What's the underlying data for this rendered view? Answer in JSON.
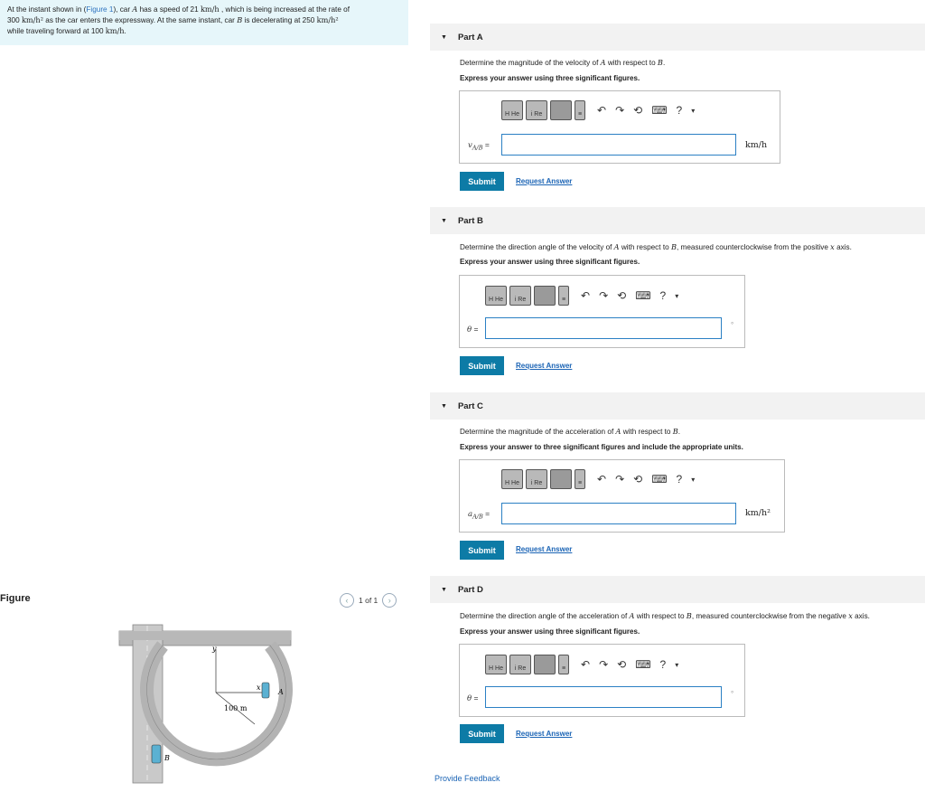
{
  "problem": {
    "line1_a": "At the instant shown in (",
    "line1_link": "Figure 1",
    "line1_b": "), car ",
    "line1_c": "A",
    "line1_d": " has a speed of 21 ",
    "line1_e": "km/h",
    "line1_f": " , which is being increased at the rate of",
    "line2_a": "300 ",
    "line2_b": "km/h²",
    "line2_c": " as the car enters the expressway. At the same instant, car ",
    "line2_d": "B",
    "line2_e": " is decelerating at 250 ",
    "line2_f": "km/h²",
    "line3_a": "while traveling forward at 100 ",
    "line3_b": "km/h",
    "line3_c": "."
  },
  "figure": {
    "title": "Figure",
    "pager": "1 of 1",
    "label_y": "y",
    "label_x": "x",
    "label_A": "A",
    "label_B": "B",
    "label_radius": "100 m"
  },
  "toolbar": {
    "t1": "H He",
    "t2": "i Re",
    "t3": "≡",
    "help": "?",
    "more": "▾"
  },
  "parts": {
    "a": {
      "title": "Part A",
      "question_a": "Determine the magnitude of the velocity of ",
      "question_b": "A",
      "question_c": " with respect to ",
      "question_d": "B",
      "question_e": ".",
      "instruction": "Express your answer using three significant figures.",
      "var": "v",
      "var_sub": "A/B",
      "eq": " =",
      "unit": "km/h",
      "submit": "Submit",
      "request": "Request Answer"
    },
    "b": {
      "title": "Part B",
      "question_a": "Determine the direction angle of the velocity of ",
      "question_b": "A",
      "question_c": " with respect to ",
      "question_d": "B",
      "question_e": ", measured counterclockwise from the positive ",
      "question_f": "x",
      "question_g": " axis.",
      "instruction": "Express your answer using three significant figures.",
      "var": "θ",
      "eq": " =",
      "unit": "°",
      "submit": "Submit",
      "request": "Request Answer"
    },
    "c": {
      "title": "Part C",
      "question_a": "Determine the magnitude of the acceleration of ",
      "question_b": "A",
      "question_c": " with respect to ",
      "question_d": "B",
      "question_e": ".",
      "instruction": "Express your answer to three significant figures and include the appropriate units.",
      "var": "a",
      "var_sub": "A/B",
      "eq": " =",
      "unit": "km/h²",
      "submit": "Submit",
      "request": "Request Answer"
    },
    "d": {
      "title": "Part D",
      "question_a": "Determine the direction angle of the acceleration of ",
      "question_b": "A",
      "question_c": " with respect to ",
      "question_d": "B",
      "question_e": ", measured counterclockwise from the negative ",
      "question_f": "x",
      "question_g": " axis.",
      "instruction": "Express your answer using three significant figures.",
      "var": "θ",
      "eq": " =",
      "unit": "°",
      "submit": "Submit",
      "request": "Request Answer"
    }
  },
  "footer": {
    "feedback": "Provide Feedback"
  },
  "colors": {
    "submit_bg": "#0d7ba6",
    "link": "#1b64b5",
    "input_border": "#2b80c4",
    "problem_bg": "#e6f6fa"
  }
}
